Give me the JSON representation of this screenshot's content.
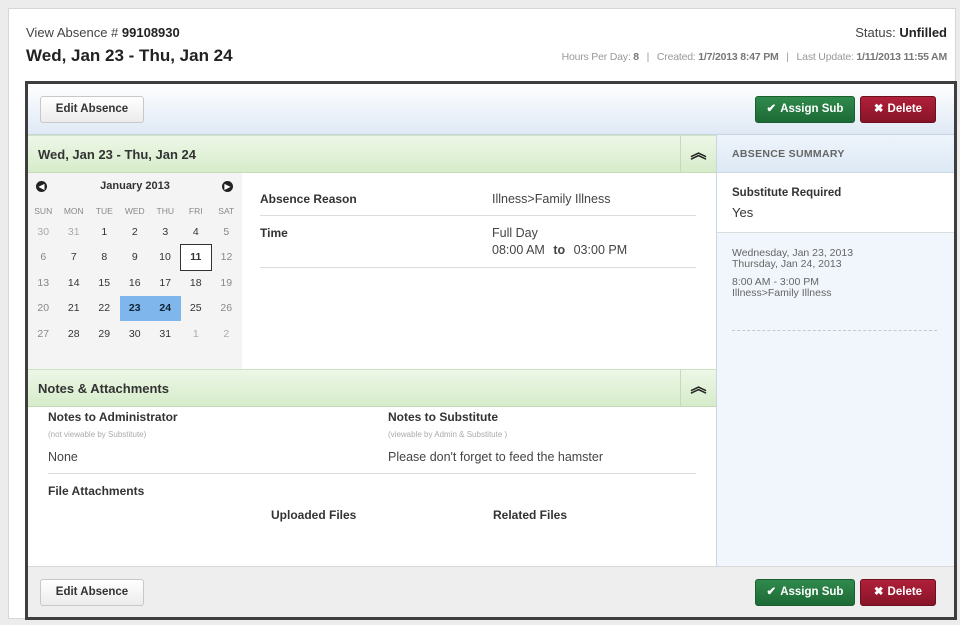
{
  "header": {
    "view_label": "View Absence #",
    "absence_number": "99108930",
    "date_range": "Wed, Jan 23 - Thu, Jan 24",
    "status_label": "Status:",
    "status_value": "Unfilled",
    "hours_label": "Hours Per Day:",
    "hours_value": "8",
    "created_label": "Created:",
    "created_value": "1/7/2013 8:47 PM",
    "updated_label": "Last Update:",
    "updated_value": "1/11/2013 11:55 AM",
    "separator": "|"
  },
  "toolbar": {
    "edit_label": "Edit Absence",
    "assign_label": "Assign Sub",
    "delete_label": "Delete",
    "assign_icon": "checkmark-icon",
    "delete_icon": "x-icon"
  },
  "details_section": {
    "title": "Wed, Jan 23 - Thu, Jan 24",
    "collapse_icon": "double-chevron-up-icon"
  },
  "calendar": {
    "title": "January 2013",
    "weekdays": [
      "SUN",
      "MON",
      "TUE",
      "WED",
      "THU",
      "FRI",
      "SAT"
    ],
    "weeks": [
      [
        "30",
        "31",
        "1",
        "2",
        "3",
        "4",
        "5"
      ],
      [
        "6",
        "7",
        "8",
        "9",
        "10",
        "11",
        "12"
      ],
      [
        "13",
        "14",
        "15",
        "16",
        "17",
        "18",
        "19"
      ],
      [
        "20",
        "21",
        "22",
        "23",
        "24",
        "25",
        "26"
      ],
      [
        "27",
        "28",
        "29",
        "30",
        "31",
        "1",
        "2"
      ]
    ],
    "today": "11",
    "selected": [
      "23",
      "24"
    ]
  },
  "details": {
    "reason_label": "Absence Reason",
    "reason_value": "Illness>Family Illness",
    "time_label": "Time",
    "time_type": "Full Day",
    "time_start": "08:00 AM",
    "time_to": "to",
    "time_end": "03:00 PM"
  },
  "notes": {
    "title": "Notes & Attachments",
    "admin_label": "Notes to Administrator",
    "admin_sub": "(not viewable by Substitute)",
    "admin_value": "None",
    "sub_label": "Notes to Substitute",
    "sub_sub": "(viewable by Admin & Substitute )",
    "sub_value": "Please don't forget to feed the hamster",
    "files_label": "File Attachments",
    "uploaded_label": "Uploaded Files",
    "related_label": "Related Files"
  },
  "summary": {
    "title": "ABSENCE SUMMARY",
    "required_label": "Substitute Required",
    "required_value": "Yes",
    "line1": "Wednesday, Jan 23, 2013",
    "line2": "Thursday, Jan 24, 2013",
    "line3": "8:00 AM - 3:00 PM",
    "line4": "Illness>Family Illness"
  },
  "colors": {
    "assign": "#1d6a36",
    "delete": "#871428",
    "selected_day": "#7fb6ec",
    "section_green": "#d6ecca"
  }
}
